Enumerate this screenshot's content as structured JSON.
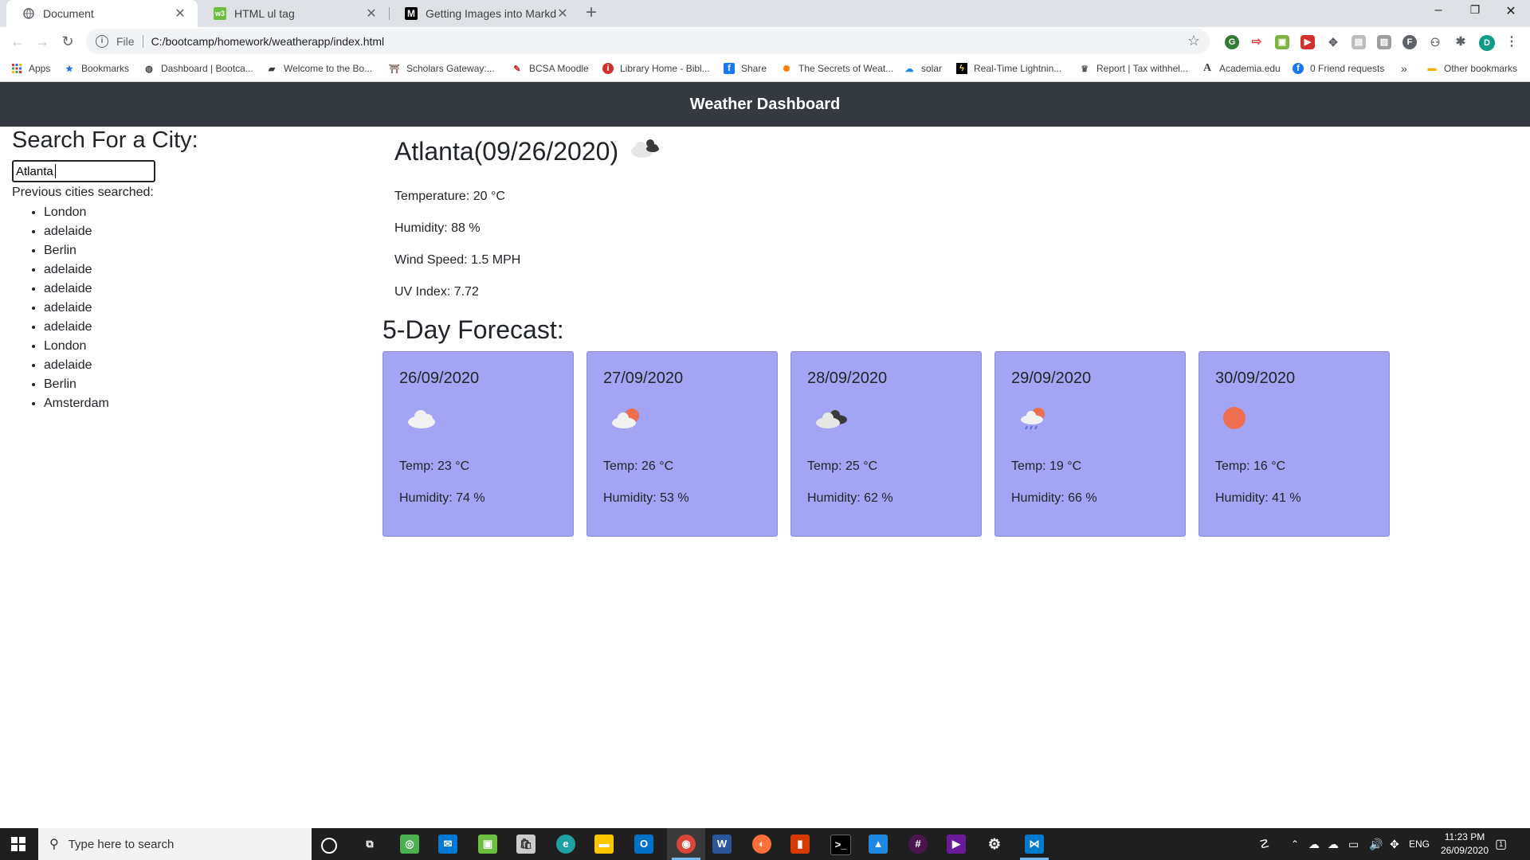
{
  "browser": {
    "tabs": [
      {
        "title": "Document",
        "active": true
      },
      {
        "title": "HTML ul tag",
        "active": false
      },
      {
        "title": "Getting Images into Markdown D",
        "active": false
      }
    ],
    "address": {
      "scheme_label": "File",
      "url": "C:/bootcamp/homework/weatherapp/index.html"
    },
    "bookmarks": [
      "Apps",
      "Bookmarks",
      "Dashboard | Bootca...",
      "Welcome to the Bo...",
      "Scholars Gateway:...",
      "BCSA Moodle",
      "Library Home - Bibl...",
      "Share",
      "The Secrets of Weat...",
      "solar",
      "Real-Time Lightnin...",
      "Report | Tax withhel...",
      "Academia.edu",
      "0 Friend requests"
    ],
    "bookmarks_more": "»",
    "other_bookmarks": "Other bookmarks",
    "profile_initial": "D"
  },
  "app": {
    "title": "Weather Dashboard",
    "search": {
      "heading": "Search For a City:",
      "value": "Atlanta",
      "history_label": "Previous cities searched:"
    },
    "history": [
      "London",
      "adelaide",
      "Berlin",
      "adelaide",
      "adelaide",
      "adelaide",
      "adelaide",
      "London",
      "adelaide",
      "Berlin",
      "Amsterdam"
    ],
    "current": {
      "heading": "Atlanta(09/26/2020)",
      "icon": "broken-clouds-icon",
      "temperature": "Temperature: 20 °C",
      "humidity": "Humidity: 88 %",
      "wind": "Wind Speed: 1.5 MPH",
      "uv": "UV Index: 7.72"
    },
    "forecast_heading": "5-Day Forecast:",
    "forecast": [
      {
        "date": "26/09/2020",
        "icon": "cloud-icon",
        "temp": "Temp: 23 °C",
        "humidity": "Humidity: 74 %"
      },
      {
        "date": "27/09/2020",
        "icon": "sun-behind-cloud-icon",
        "temp": "Temp: 26 °C",
        "humidity": "Humidity: 53 %"
      },
      {
        "date": "28/09/2020",
        "icon": "broken-clouds-icon",
        "temp": "Temp: 25 °C",
        "humidity": "Humidity: 62 %"
      },
      {
        "date": "29/09/2020",
        "icon": "rain-cloud-sun-icon",
        "temp": "Temp: 19 °C",
        "humidity": "Humidity: 66 %"
      },
      {
        "date": "30/09/2020",
        "icon": "sun-icon",
        "temp": "Temp: 16 °C",
        "humidity": "Humidity: 41 %"
      }
    ]
  },
  "taskbar": {
    "search_placeholder": "Type here to search",
    "language": "ENG",
    "time": "11:23 PM",
    "date": "26/09/2020",
    "notification_count": "1"
  },
  "colors": {
    "header_bg": "#343a40",
    "card_bg": "#a3a5f4",
    "sun": "#ee6e4f"
  }
}
